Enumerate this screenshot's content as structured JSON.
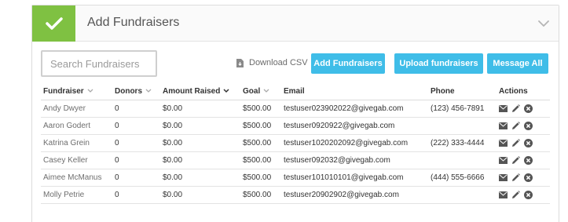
{
  "header": {
    "title": "Add Fundraisers",
    "check_icon": "check-icon",
    "collapse_icon": "chevron-down-icon",
    "accent_color": "#7fc142"
  },
  "toolbar": {
    "search_placeholder": "Search Fundraisers",
    "download_label": "Download CSV",
    "download_icon": "download-file-icon",
    "add_label": "Add Fundraisers",
    "upload_label": "Upload fundraisers",
    "message_label": "Message All",
    "button_color": "#3fbde8"
  },
  "table": {
    "columns": {
      "fundraiser": "Fundraiser",
      "donors": "Donors",
      "amount": "Amount Raised",
      "goal": "Goal",
      "email": "Email",
      "phone": "Phone",
      "actions": "Actions"
    },
    "action_icons": [
      "envelope-icon",
      "pencil-icon",
      "remove-icon"
    ],
    "rows": [
      {
        "name": "Andy Dwyer",
        "donors": "0",
        "amount": "$0.00",
        "goal": "$500.00",
        "email": "testuser023902022@givegab.com",
        "phone": "(123) 456-7891"
      },
      {
        "name": "Aaron Godert",
        "donors": "0",
        "amount": "$0.00",
        "goal": "$500.00",
        "email": "testuser0920922@givegab.com",
        "phone": ""
      },
      {
        "name": "Katrina Grein",
        "donors": "0",
        "amount": "$0.00",
        "goal": "$500.00",
        "email": "testuser1020202092@givegab.com",
        "phone": "(222) 333-4444"
      },
      {
        "name": "Casey Keller",
        "donors": "0",
        "amount": "$0.00",
        "goal": "$500.00",
        "email": "testuser092032@givegab.com",
        "phone": ""
      },
      {
        "name": "Aimee McManus",
        "donors": "0",
        "amount": "$0.00",
        "goal": "$500.00",
        "email": "testuser101010101@givegab.com",
        "phone": "(444) 555-6666"
      },
      {
        "name": "Molly Petrie",
        "donors": "0",
        "amount": "$0.00",
        "goal": "$500.00",
        "email": "testuser20902902@givegab.com",
        "phone": ""
      }
    ]
  }
}
